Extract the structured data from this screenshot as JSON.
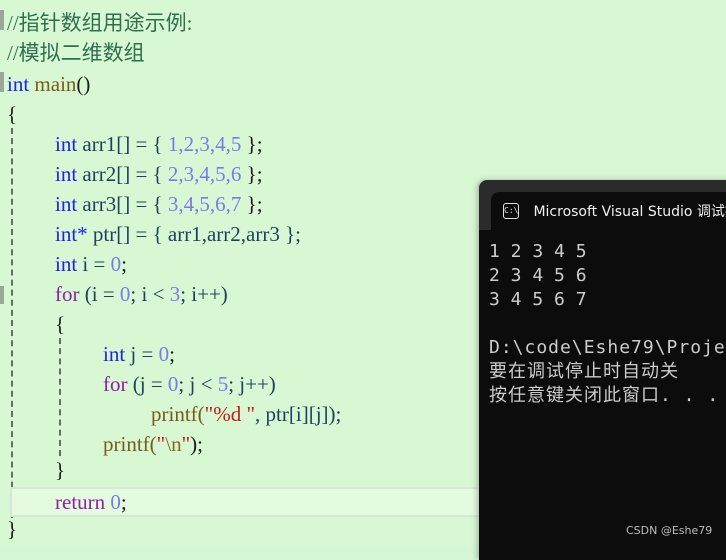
{
  "editor": {
    "comments": [
      "//指针数组用途示例:",
      "//模拟二维数组"
    ],
    "code": {
      "signature_type": "int",
      "signature_name": "main",
      "signature_parens": "()",
      "open_brace": "{",
      "arr1_type": "int",
      "arr1_name": " arr1[] = { ",
      "arr1_values": "1,2,3,4,5",
      "arr1_end": " };",
      "arr2_type": "int",
      "arr2_name": " arr2[] = { ",
      "arr2_values": "2,3,4,5,6",
      "arr2_end": " };",
      "arr3_type": "int",
      "arr3_name": " arr3[] = { ",
      "arr3_values": "3,4,5,6,7",
      "arr3_end": " };",
      "ptr_type": "int*",
      "ptr_decl": " ptr[] = { arr1,arr2,arr3 };",
      "i_type": "int",
      "i_decl": " i = ",
      "i_val": "0",
      "i_end": ";",
      "for1_kw": "for",
      "for1_a": " (i = ",
      "for1_0": "0",
      "for1_b": "; i < ",
      "for1_3": "3",
      "for1_c": "; i++)",
      "inner_open": "{",
      "j_type": "int",
      "j_decl": " j = ",
      "j_val": "0",
      "j_end": ";",
      "for2_kw": "for",
      "for2_a": " (j = ",
      "for2_0": "0",
      "for2_b": "; j < ",
      "for2_5": "5",
      "for2_c": "; j++)",
      "printf1_fn": "printf",
      "printf1_open": "(",
      "printf1_str": "\"%d \"",
      "printf1_rest": ", ptr[i][j]);",
      "printf2_fn": "printf",
      "printf2_open": "(",
      "printf2_q1": "\"",
      "printf2_esc": "\\n",
      "printf2_q2": "\"",
      "printf2_rest": ");",
      "inner_close": "}",
      "return_kw": "return",
      "return_val": "0",
      "return_end": ";",
      "close_brace": "}"
    }
  },
  "console": {
    "title": "Microsoft Visual Studio 调试控制台",
    "icon": "console-icon",
    "output_lines": [
      "1 2 3 4 5",
      "2 3 4 5 6",
      "3 4 5 6 7"
    ],
    "path_line": "D:\\code\\Eshe79\\Proje",
    "message_line_1": "要在调试停止时自动关",
    "message_line_2": "按任意键关闭此窗口. . ."
  },
  "watermark": "CSDN @Eshe79"
}
